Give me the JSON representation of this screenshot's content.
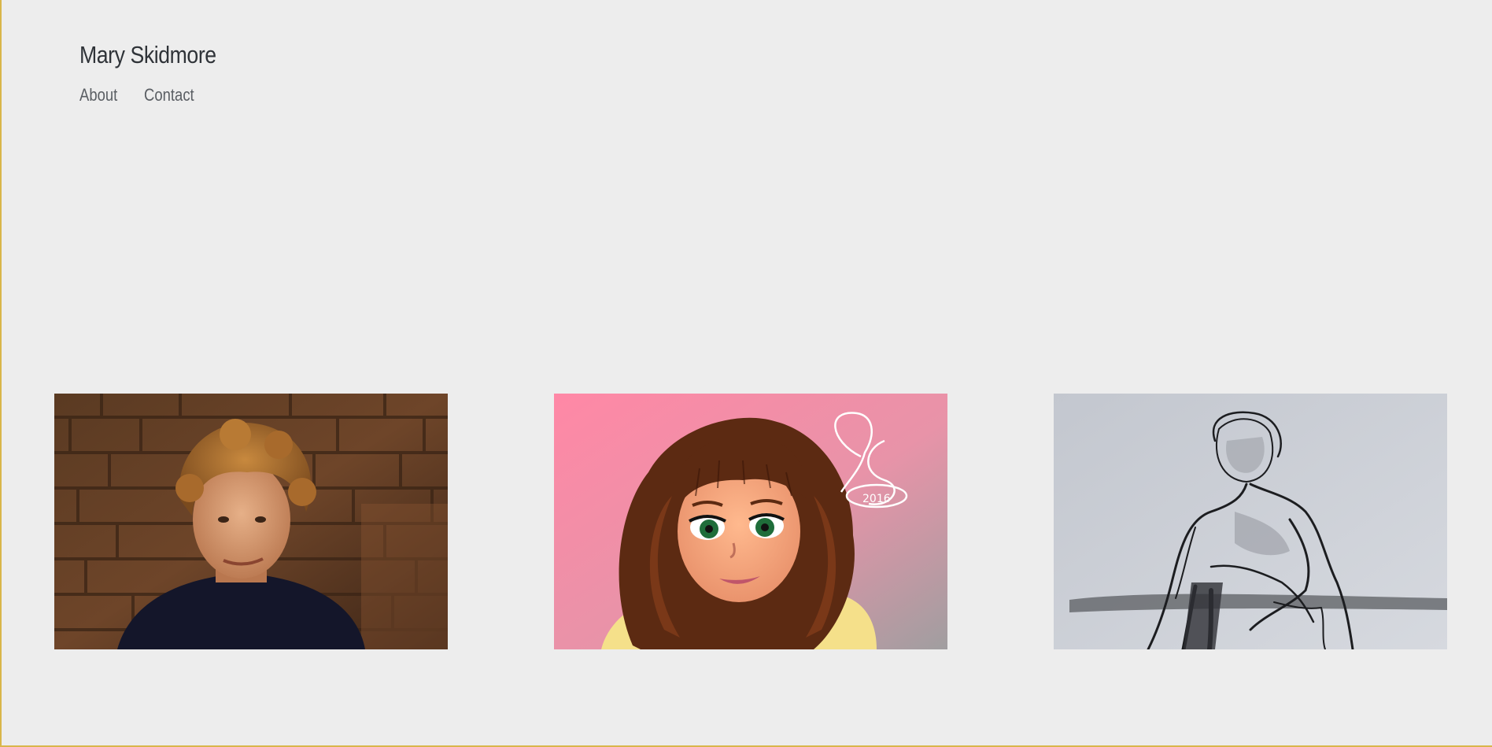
{
  "site": {
    "title": "Mary Skidmore"
  },
  "nav": {
    "items": [
      {
        "label": "About"
      },
      {
        "label": "Contact"
      }
    ]
  },
  "gallery": {
    "items": [
      {
        "subject": "photograph-portrait-boy-brick-wall"
      },
      {
        "subject": "digital-illustration-girl-portrait",
        "signature_year": "2016"
      },
      {
        "subject": "ink-sketch-seated-figure"
      }
    ]
  },
  "colors": {
    "background": "#ededed",
    "title_text": "#2f3338",
    "nav_text": "#5a5e63",
    "frame_accent": "#d9b64a"
  }
}
